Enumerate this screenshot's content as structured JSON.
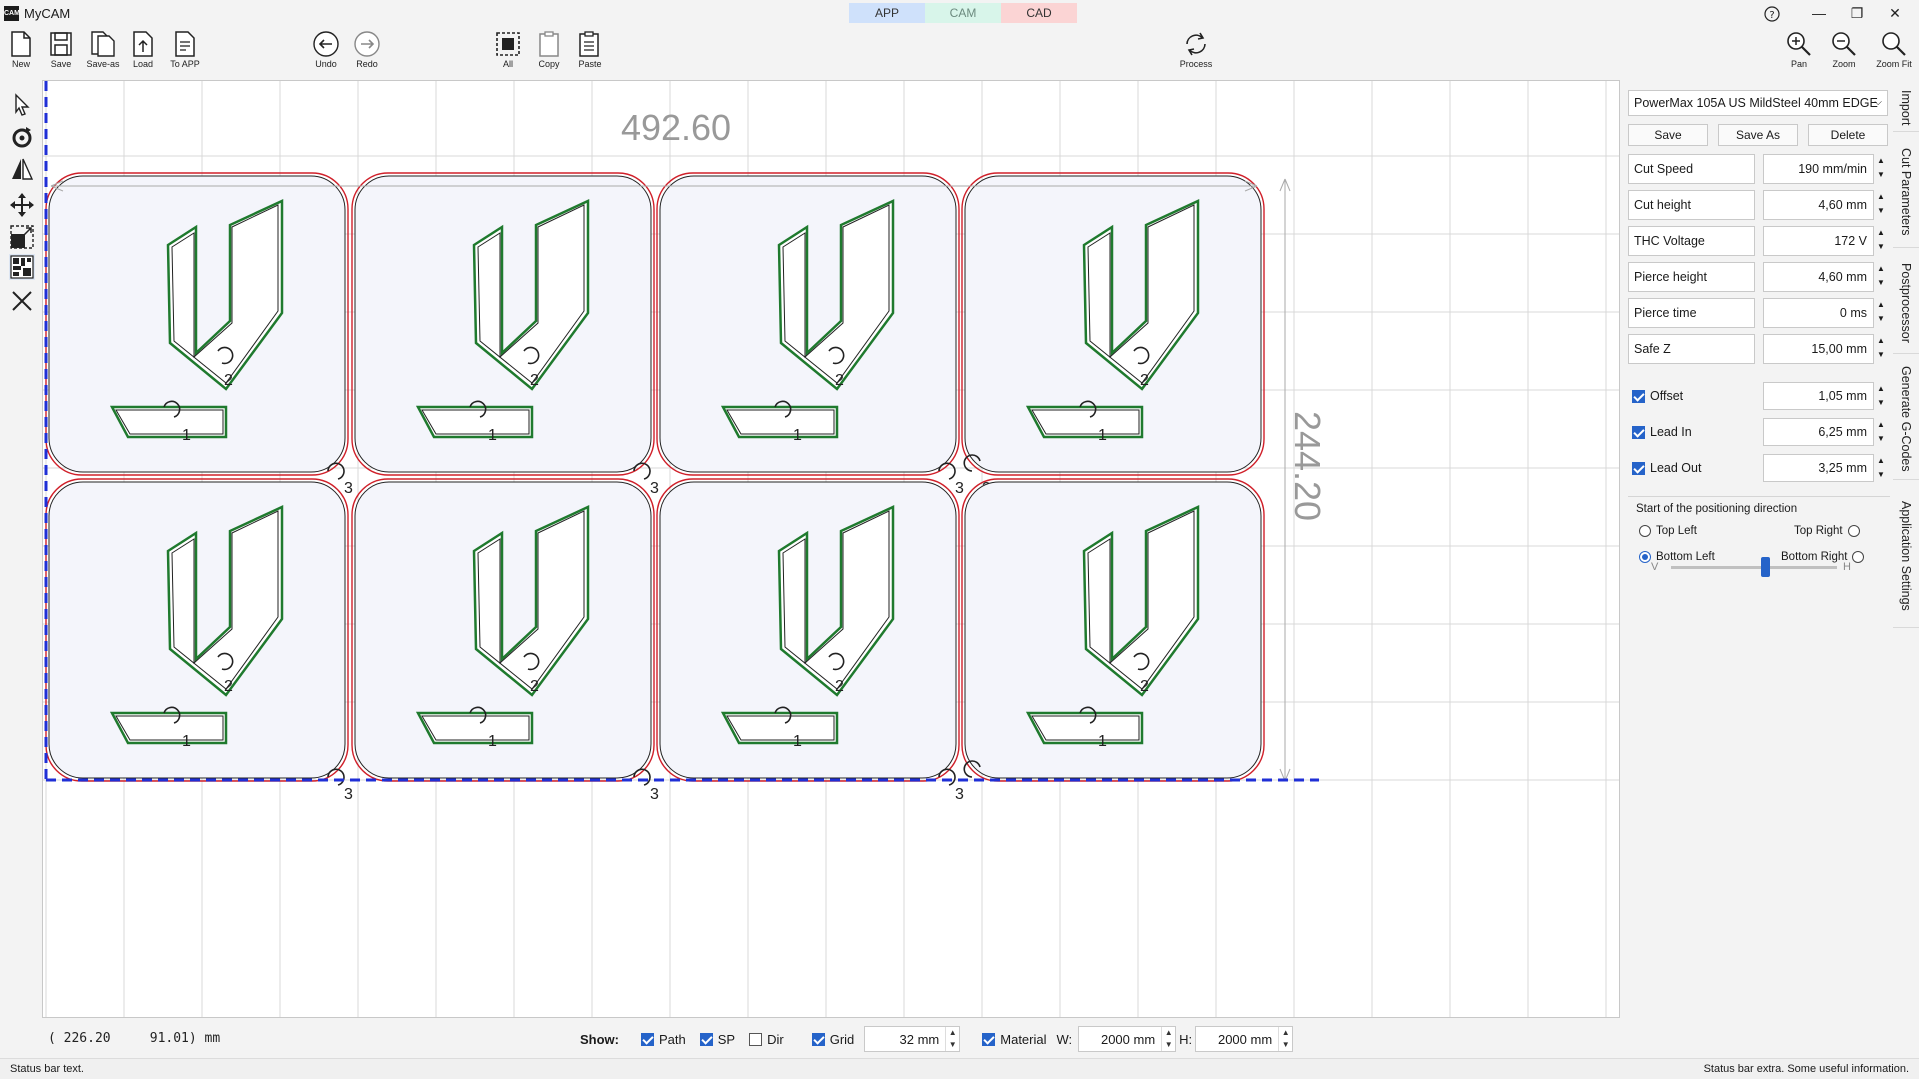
{
  "app": {
    "title": "MyCAM",
    "logo_text": "CAM"
  },
  "mode_tabs": [
    {
      "label": "APP"
    },
    {
      "label": "CAM"
    },
    {
      "label": "CAD"
    }
  ],
  "window_controls": {
    "help": "?",
    "minimize": "—",
    "restore": "❐",
    "close": "✕"
  },
  "toolbar": {
    "new": "New",
    "save": "Save",
    "save_as": "Save-as",
    "load": "Load",
    "to_app": "To APP",
    "undo": "Undo",
    "redo": "Redo",
    "all": "All",
    "copy": "Copy",
    "paste": "Paste",
    "process": "Process",
    "pan": "Pan",
    "zoom": "Zoom",
    "zoom_fit": "Zoom Fit"
  },
  "canvas": {
    "dim_horizontal": "492.60",
    "dim_vertical": "244.20",
    "part_labels": {
      "inner_a": "1",
      "inner_b": "2",
      "outer": "3"
    },
    "colors": {
      "outer_contour": "#d0202a",
      "inner_contour": "#1f7a2e",
      "origin_axis": "#1f2fd6",
      "part_fill": "#f4f5fb",
      "grid": "#d9d9d9"
    }
  },
  "coords": {
    "text": "( 226.20     91.01) mm"
  },
  "showbar": {
    "label": "Show:",
    "path": {
      "label": "Path",
      "checked": true
    },
    "sp": {
      "label": "SP",
      "checked": true
    },
    "dir": {
      "label": "Dir",
      "checked": false
    },
    "grid": {
      "label": "Grid",
      "checked": true,
      "value": "32 mm"
    },
    "material": {
      "label": "Material",
      "checked": true
    },
    "w_label": "W:",
    "w_value": "2000 mm",
    "h_label": "H:",
    "h_value": "2000 mm"
  },
  "status": {
    "left": "Status bar text.",
    "right": "Status bar extra. Some useful information."
  },
  "panel": {
    "preset": "PowerMax 105A US MildSteel 40mm EDGE",
    "buttons": {
      "save": "Save",
      "save_as": "Save As",
      "delete": "Delete"
    },
    "params": [
      {
        "label": "Cut Speed",
        "value": "190 mm/min"
      },
      {
        "label": "Cut height",
        "value": "4,60 mm"
      },
      {
        "label": "THC Voltage",
        "value": "172 V"
      },
      {
        "label": "Pierce height",
        "value": "4,60 mm"
      },
      {
        "label": "Pierce time",
        "value": "0 ms"
      },
      {
        "label": "Safe Z",
        "value": "15,00 mm"
      }
    ],
    "options": [
      {
        "label": "Offset",
        "value": "1,05 mm",
        "checked": true
      },
      {
        "label": "Lead In",
        "value": "6,25 mm",
        "checked": true
      },
      {
        "label": "Lead Out",
        "value": "3,25 mm",
        "checked": true
      }
    ],
    "positioning": {
      "title": "Start of the positioning direction",
      "top_left": "Top Left",
      "top_right": "Top Right",
      "bottom_left": "Bottom Left",
      "bottom_right": "Bottom Right",
      "selected": "Bottom Left",
      "slider_v": "V",
      "slider_h": "H"
    }
  },
  "side_tabs": [
    {
      "label": "Import"
    },
    {
      "label": "Cut Parameters"
    },
    {
      "label": "Postprocessor"
    },
    {
      "label": "Generate G-Codes"
    },
    {
      "label": "Application Settings"
    }
  ]
}
